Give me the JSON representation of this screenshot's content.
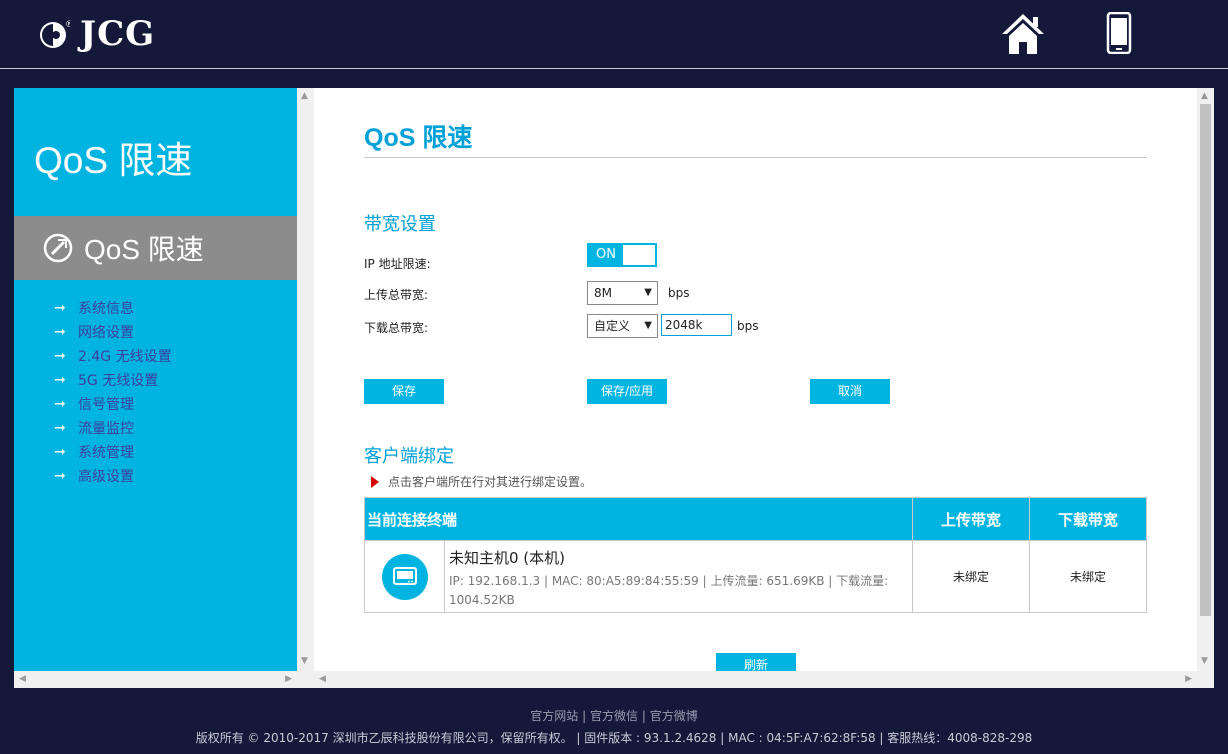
{
  "brand": {
    "name": "JCG",
    "registered": "®"
  },
  "header": {
    "icons": [
      "home-icon",
      "mobile-icon"
    ]
  },
  "sidebar": {
    "title": "QoS 限速",
    "active_item": "QoS 限速",
    "menu": [
      {
        "label": "系统信息"
      },
      {
        "label": "网络设置"
      },
      {
        "label": "2.4G 无线设置"
      },
      {
        "label": "5G 无线设置"
      },
      {
        "label": "信号管理"
      },
      {
        "label": "流量监控"
      },
      {
        "label": "系统管理"
      },
      {
        "label": "高级设置"
      }
    ],
    "arrow": "➞"
  },
  "main": {
    "title": "QoS 限速",
    "bandwidth": {
      "section_title": "带宽设置",
      "ip_limit_label": "IP 地址限速:",
      "ip_limit_state": "ON",
      "upload_label": "上传总带宽:",
      "upload_value": "8M",
      "upload_unit": "bps",
      "download_label": "下载总带宽:",
      "download_mode": "自定义",
      "download_value": "2048k",
      "download_unit": "bps"
    },
    "buttons": {
      "save": "保存",
      "save_apply": "保存/应用",
      "cancel": "取消"
    },
    "clients": {
      "section_title": "客户端绑定",
      "hint": "点击客户端所在行对其进行绑定设置。",
      "columns": {
        "host": "当前连接终端",
        "upload": "上传带宽",
        "download": "下载带宽"
      },
      "rows": [
        {
          "name": "未知主机0 (本机)",
          "details": "IP: 192.168.1.3 | MAC: 80:A5:89:84:55:59 | 上传流量: 651.69KB | 下载流量: 1004.52KB",
          "upload": "未绑定",
          "download": "未绑定"
        }
      ]
    },
    "refresh": "刷新"
  },
  "footer": {
    "links": [
      "官方网站",
      "官方微信",
      "官方微博"
    ],
    "separator": "|",
    "copyright": "版权所有 © 2010-2017 深圳市乙辰科技股份有限公司，保留所有权。 | 固件版本 : 93.1.2.4628 | MAC : 04:5F:A7:62:8F:58 | 客服热线：4008-828-298"
  },
  "colors": {
    "accent": "#00b4e1",
    "title": "#00a0d8",
    "header_bg": "#14193a",
    "sidebar_active": "#8c8c8c",
    "hint_arrow": "#d40000"
  }
}
